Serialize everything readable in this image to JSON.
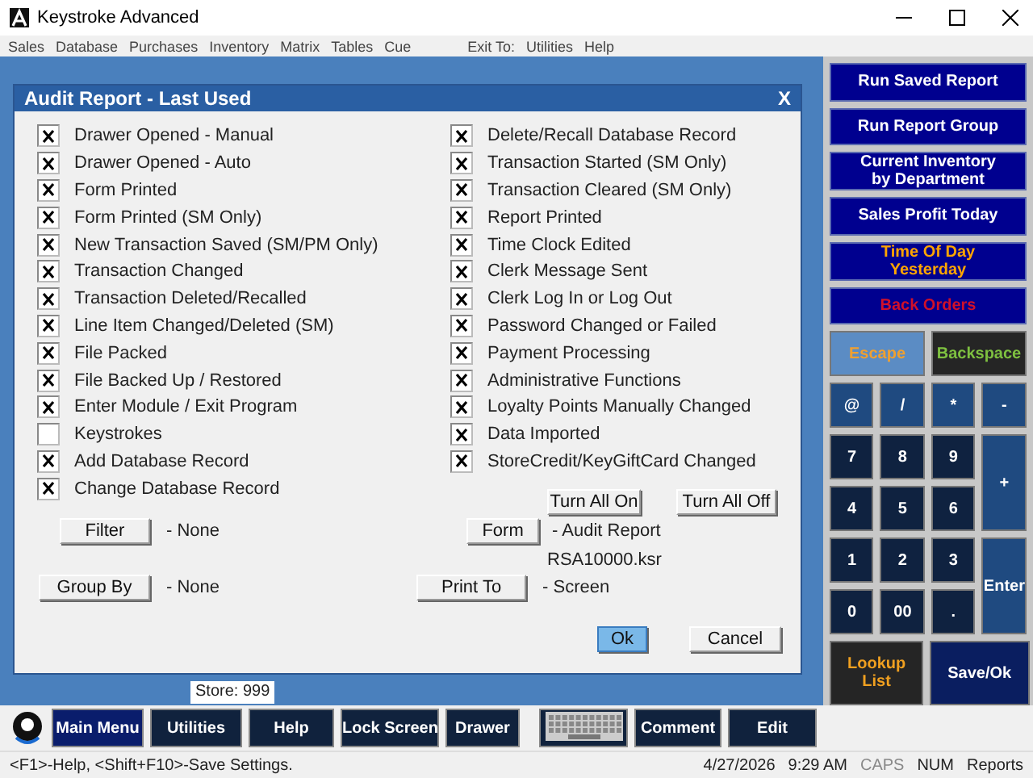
{
  "window": {
    "title": "Keystroke Advanced"
  },
  "menu": [
    "Sales",
    "Database",
    "Purchases",
    "Inventory",
    "Matrix",
    "Tables",
    "Cue",
    "Exit To:",
    "Utilities",
    "Help"
  ],
  "dialog": {
    "title": "Audit Report - Last Used",
    "close": "X",
    "left_options": [
      {
        "label": "Drawer Opened - Manual",
        "checked": true
      },
      {
        "label": "Drawer Opened - Auto",
        "checked": true
      },
      {
        "label": "Form Printed",
        "checked": true
      },
      {
        "label": "Form Printed (SM Only)",
        "checked": true
      },
      {
        "label": "New Transaction Saved (SM/PM Only)",
        "checked": true
      },
      {
        "label": "Transaction Changed",
        "checked": true
      },
      {
        "label": "Transaction Deleted/Recalled",
        "checked": true
      },
      {
        "label": "Line Item Changed/Deleted (SM)",
        "checked": true
      },
      {
        "label": "File Packed",
        "checked": true
      },
      {
        "label": "File Backed Up / Restored",
        "checked": true
      },
      {
        "label": "Enter Module / Exit Program",
        "checked": true
      },
      {
        "label": "Keystrokes",
        "checked": false
      },
      {
        "label": "Add Database Record",
        "checked": true
      },
      {
        "label": "Change Database Record",
        "checked": true
      }
    ],
    "right_options": [
      {
        "label": "Delete/Recall Database Record",
        "checked": true
      },
      {
        "label": "Transaction Started (SM Only)",
        "checked": true
      },
      {
        "label": "Transaction Cleared (SM Only)",
        "checked": true
      },
      {
        "label": "Report Printed",
        "checked": true
      },
      {
        "label": "Time Clock Edited",
        "checked": true
      },
      {
        "label": "Clerk Message Sent",
        "checked": true
      },
      {
        "label": "Clerk Log In or Log Out",
        "checked": true
      },
      {
        "label": "Password Changed or Failed",
        "checked": true
      },
      {
        "label": "Payment Processing",
        "checked": true
      },
      {
        "label": "Administrative Functions",
        "checked": true
      },
      {
        "label": "Loyalty Points Manually Changed",
        "checked": true
      },
      {
        "label": "Data Imported",
        "checked": true
      },
      {
        "label": "StoreCredit/KeyGiftCard Changed",
        "checked": true
      }
    ],
    "turn_all_on": "Turn All On",
    "turn_all_off": "Turn All Off",
    "filter": {
      "button": "Filter",
      "value": "- None"
    },
    "form": {
      "button": "Form",
      "value": "- Audit Report",
      "file": "RSA10000.ksr"
    },
    "group_by": {
      "button": "Group By",
      "value": "- None"
    },
    "print_to": {
      "button": "Print To",
      "value": "- Screen"
    },
    "ok": "Ok",
    "cancel": "Cancel"
  },
  "store": "Store: 999",
  "side_buttons": [
    {
      "label": "Run Saved Report",
      "kind": "normal"
    },
    {
      "label": "Run Report Group",
      "kind": "normal"
    },
    {
      "label": "Current Inventory by Department",
      "kind": "normal"
    },
    {
      "label": "Sales Profit Today",
      "kind": "normal"
    },
    {
      "label": "Time Of Day Yesterday",
      "kind": "highlight"
    },
    {
      "label": "Back Orders",
      "kind": "alert"
    }
  ],
  "edit_keys": [
    {
      "label": "Escape",
      "kind": "light"
    },
    {
      "label": "Backspace",
      "kind": "black"
    }
  ],
  "keypad": [
    {
      "label": "@",
      "kind": "op"
    },
    {
      "label": "/",
      "kind": "op"
    },
    {
      "label": "*",
      "kind": "op"
    },
    {
      "label": "-",
      "kind": "op"
    },
    {
      "label": "7",
      "kind": "digit"
    },
    {
      "label": "8",
      "kind": "digit"
    },
    {
      "label": "9",
      "kind": "digit"
    },
    {
      "label": "+",
      "kind": "tall"
    },
    {
      "label": "4",
      "kind": "digit"
    },
    {
      "label": "5",
      "kind": "digit"
    },
    {
      "label": "6",
      "kind": "digit"
    },
    {
      "label": "1",
      "kind": "digit"
    },
    {
      "label": "2",
      "kind": "digit"
    },
    {
      "label": "3",
      "kind": "digit"
    },
    {
      "label": "Enter",
      "kind": "tall"
    },
    {
      "label": "0",
      "kind": "digit"
    },
    {
      "label": "00",
      "kind": "digit"
    },
    {
      "label": ".",
      "kind": "digit"
    }
  ],
  "bottom_keys": [
    {
      "label": "Lookup List",
      "kind": "black"
    },
    {
      "label": "Save/Ok",
      "kind": "navy"
    }
  ],
  "toolbar": [
    {
      "label": "Main Menu",
      "kind": "button",
      "selected": true
    },
    {
      "label": "Utilities",
      "kind": "button",
      "selected": false
    },
    {
      "label": "Help",
      "kind": "button",
      "selected": false
    },
    {
      "label": "Lock Screen",
      "kind": "button",
      "selected": false
    },
    {
      "label": "Drawer",
      "kind": "button",
      "selected": false
    },
    {
      "kind": "keyboard",
      "selected": false
    },
    {
      "label": "Comment",
      "kind": "button",
      "selected": false
    },
    {
      "label": "Edit",
      "kind": "button",
      "selected": false
    }
  ],
  "status_bar": {
    "hint": "<F1>-Help, <Shift+F10>-Save Settings.",
    "date": "4/27/2026",
    "time": "9:29 AM",
    "indicators": [
      {
        "label": "CAPS",
        "on": false
      },
      {
        "label": "NUM",
        "on": true
      },
      {
        "label": "Reports",
        "on": true
      }
    ]
  }
}
